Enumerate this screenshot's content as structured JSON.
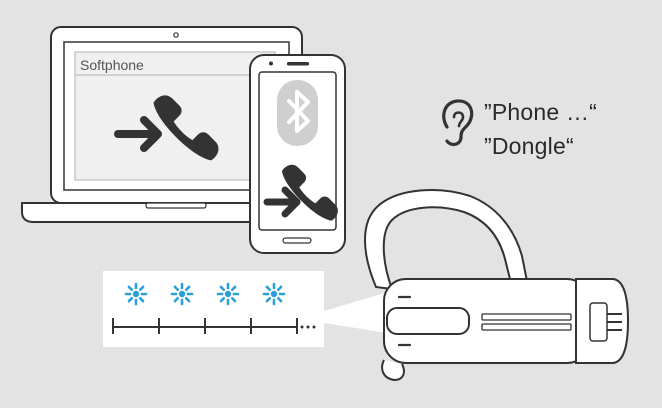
{
  "laptop": {
    "screen_title": "Softphone"
  },
  "voice_prompt": {
    "icon": "ear-icon",
    "lines": [
      "”Phone …“",
      "”Dongle“"
    ]
  },
  "led_sequence": {
    "flash_count": 4,
    "flash_color": "#2a9fd8",
    "continues": true
  },
  "colors": {
    "background": "#e3e3e3",
    "outline": "#333333",
    "call_icon": "#333333",
    "bluetooth_badge": "#cfcfcf",
    "led": "#2a9fd8"
  }
}
